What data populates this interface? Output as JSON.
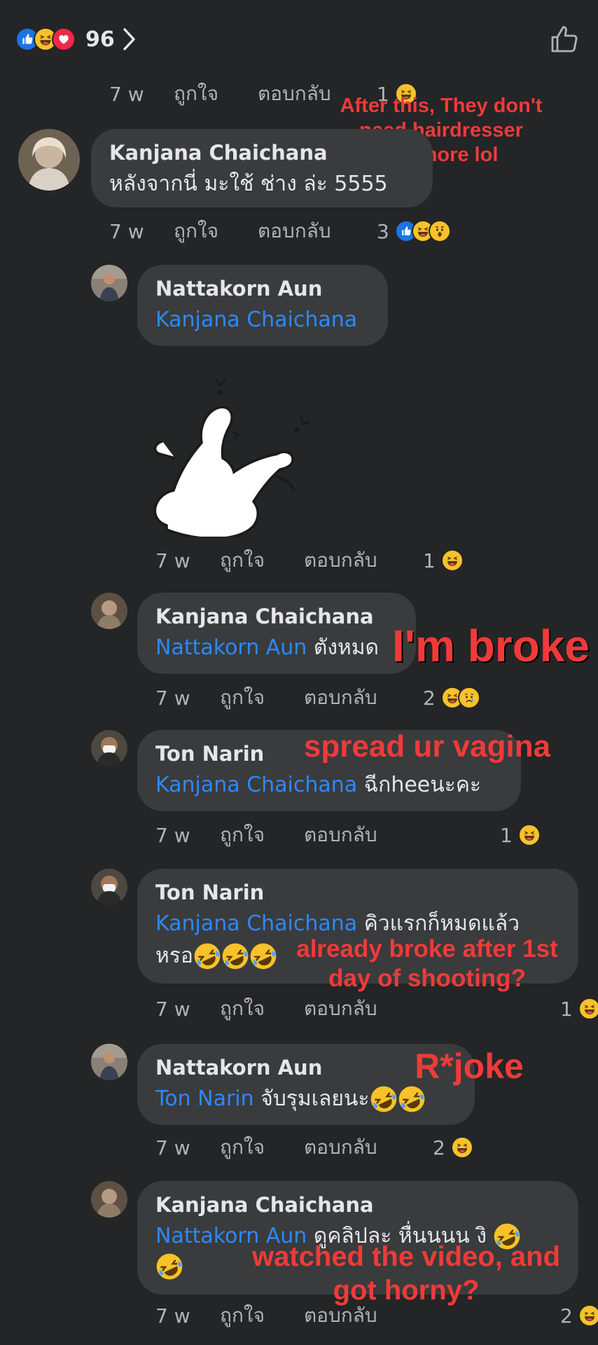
{
  "top_bar": {
    "reaction_count": "96"
  },
  "comments": [
    {
      "time": "7 w",
      "like": "ถูกใจ",
      "reply": "ตอบกลับ",
      "count": "1"
    },
    {
      "name": "Kanjana Chaichana",
      "text": "หลังจากนี่ มะใช้ ช่าง ล่ะ 5555",
      "time": "7 w",
      "like": "ถูกใจ",
      "reply": "ตอบกลับ",
      "count": "3"
    },
    {
      "name": "Nattakorn Aun",
      "mention": "Kanjana Chaichana",
      "time": "7 w",
      "like": "ถูกใจ",
      "reply": "ตอบกลับ",
      "count": "1"
    },
    {
      "name": "Kanjana Chaichana",
      "mention": "Nattakorn Aun",
      "text": "ตังหมด",
      "time": "7 w",
      "like": "ถูกใจ",
      "reply": "ตอบกลับ",
      "count": "2"
    },
    {
      "name": "Ton Narin",
      "mention": "Kanjana Chaichana",
      "text": "ฉีกheeนะคะ",
      "time": "7 w",
      "like": "ถูกใจ",
      "reply": "ตอบกลับ",
      "count": "1"
    },
    {
      "name": "Ton Narin",
      "mention": "Kanjana Chaichana",
      "text": "คิวแรกก็หมดแล้ว",
      "text2": "หรอ",
      "time": "7 w",
      "like": "ถูกใจ",
      "reply": "ตอบกลับ",
      "count": "1"
    },
    {
      "name": "Nattakorn Aun",
      "mention": "Ton Narin",
      "text": "จับรุมเลยนะ",
      "time": "7 w",
      "like": "ถูกใจ",
      "reply": "ตอบกลับ",
      "count": "2"
    },
    {
      "name": "Kanjana Chaichana",
      "mention": "Nattakorn Aun",
      "text": "ดูคลิปละ หื่นนนน งิ",
      "time": "7 w",
      "like": "ถูกใจ",
      "reply": "ตอบกลับ",
      "count": "2"
    }
  ],
  "overlays": {
    "hairdresser": "After this, They don't need hairdresser anymore lol",
    "broke": "I'm broke",
    "spread": "spread ur vagina",
    "already_broke": "already broke after 1st day of shooting?",
    "rjoke": "R*joke",
    "horny": "watched the video, and got horny?"
  },
  "colors": {
    "background": "#242526",
    "bubble": "#3a3b3c",
    "mention": "#2d88ff",
    "meta": "#b0b3b8",
    "overlay": "#f03a3a"
  },
  "icons": [
    "like-reaction-icon",
    "haha-reaction-icon",
    "love-reaction-icon",
    "wow-reaction-icon",
    "sad-reaction-icon",
    "laughing-tears-emoji",
    "chevron-right-icon",
    "thumbs-up-outline-icon",
    "chicken-sticker"
  ]
}
